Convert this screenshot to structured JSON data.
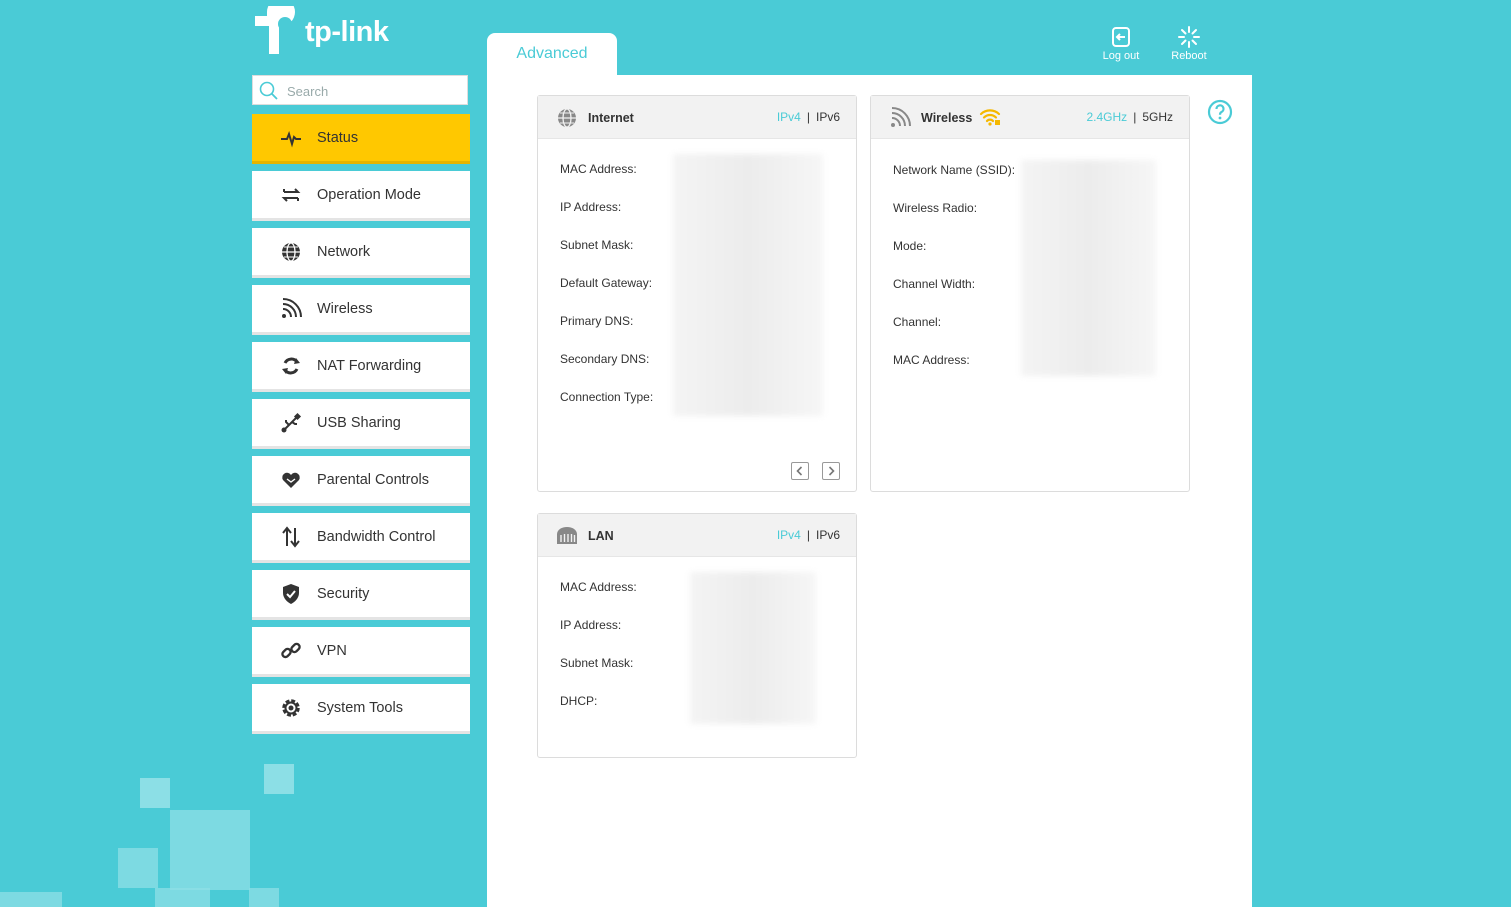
{
  "brand": {
    "logo_text": "tp-link"
  },
  "search": {
    "placeholder": "Search"
  },
  "sidebar": {
    "items": [
      {
        "label": "Status",
        "icon": "pulse-icon",
        "active": true
      },
      {
        "label": "Operation Mode",
        "icon": "swap-arrows-icon"
      },
      {
        "label": "Network",
        "icon": "globe-icon"
      },
      {
        "label": "Wireless",
        "icon": "wifi-signal-icon"
      },
      {
        "label": "NAT Forwarding",
        "icon": "refresh-icon"
      },
      {
        "label": "USB Sharing",
        "icon": "usb-icon"
      },
      {
        "label": "Parental Controls",
        "icon": "heart-icon"
      },
      {
        "label": "Bandwidth Control",
        "icon": "up-down-arrows-icon"
      },
      {
        "label": "Security",
        "icon": "shield-icon"
      },
      {
        "label": "VPN",
        "icon": "link-icon"
      },
      {
        "label": "System Tools",
        "icon": "gear-icon"
      }
    ]
  },
  "header": {
    "tab_advanced": "Advanced",
    "logout_label": "Log out",
    "reboot_label": "Reboot"
  },
  "internet_card": {
    "title": "Internet",
    "tab_ipv4": "IPv4",
    "tab_sep": "|",
    "tab_ipv6": "IPv6",
    "fields": [
      "MAC Address:",
      "IP Address:",
      "Subnet Mask:",
      "Default Gateway:",
      "Primary DNS:",
      "Secondary DNS:",
      "Connection Type:"
    ]
  },
  "wireless_card": {
    "title": "Wireless",
    "tab_24": "2.4GHz",
    "tab_sep": "|",
    "tab_5": "5GHz",
    "fields": [
      "Network Name (SSID):",
      "Wireless Radio:",
      "Mode:",
      "Channel Width:",
      "Channel:",
      "MAC Address:"
    ]
  },
  "lan_card": {
    "title": "LAN",
    "tab_ipv4": "IPv4",
    "tab_sep": "|",
    "tab_ipv6": "IPv6",
    "fields": [
      "MAC Address:",
      "IP Address:",
      "Subnet Mask:",
      "DHCP:"
    ]
  },
  "colors": {
    "accent": "#4ACBD6",
    "active": "#FFC800",
    "wifi_icon": "#F5B800"
  }
}
